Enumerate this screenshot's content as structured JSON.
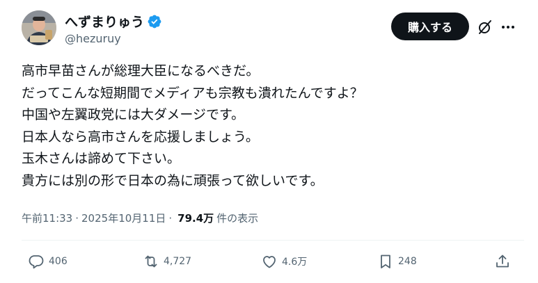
{
  "author": {
    "display_name": "へずまりゅう",
    "handle": "@hezuruy",
    "verified_icon": "verified-badge-icon",
    "accent_color": "#1d9bf0"
  },
  "header": {
    "buy_label": "購入する",
    "grok_icon": "slashed-circle-icon",
    "more_icon": "more-dots-icon"
  },
  "tweet": {
    "lines": [
      "高市早苗さんが総理大臣になるべきだ。",
      "だってこんな短期間でメディアも宗教も潰れたんですよ？",
      "中国や左翼政党には大ダメージです。",
      "日本人なら高市さんを応援しましょう。",
      "玉木さんは諦めて下さい。",
      "貴方には別の形で日本の為に頑張って欲しいです。"
    ]
  },
  "meta": {
    "time": "午前11:33",
    "separator": "·",
    "date": "2025年10月11日",
    "views_count": "79.4万",
    "views_label": "件の表示"
  },
  "actions": {
    "reply_count": "406",
    "repost_count": "4,727",
    "like_count": "4.6万",
    "bookmark_count": "248"
  }
}
